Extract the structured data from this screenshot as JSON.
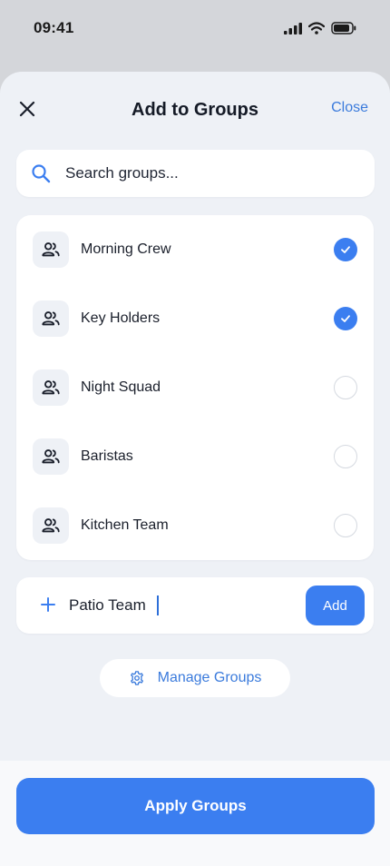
{
  "status_bar": {
    "time": "09:41"
  },
  "header": {
    "title": "Add to Groups",
    "close_label": "Close"
  },
  "search": {
    "placeholder": "Search groups..."
  },
  "groups": [
    {
      "name": "Morning Crew",
      "selected": true
    },
    {
      "name": "Key Holders",
      "selected": true
    },
    {
      "name": "Night Squad",
      "selected": false
    },
    {
      "name": "Baristas",
      "selected": false
    },
    {
      "name": "Kitchen Team",
      "selected": false
    }
  ],
  "new_group": {
    "value": "Patio Team",
    "add_label": "Add"
  },
  "manage": {
    "label": "Manage Groups"
  },
  "footer": {
    "apply_label": "Apply Groups"
  },
  "colors": {
    "accent": "#3b7ef0",
    "link": "#3b7bdc",
    "sheet_bg": "#eef1f6"
  },
  "icons": {
    "close": "close-icon",
    "search": "search-icon",
    "group": "group-icon",
    "check": "check-icon",
    "plus": "plus-icon",
    "gear": "gear-icon"
  }
}
